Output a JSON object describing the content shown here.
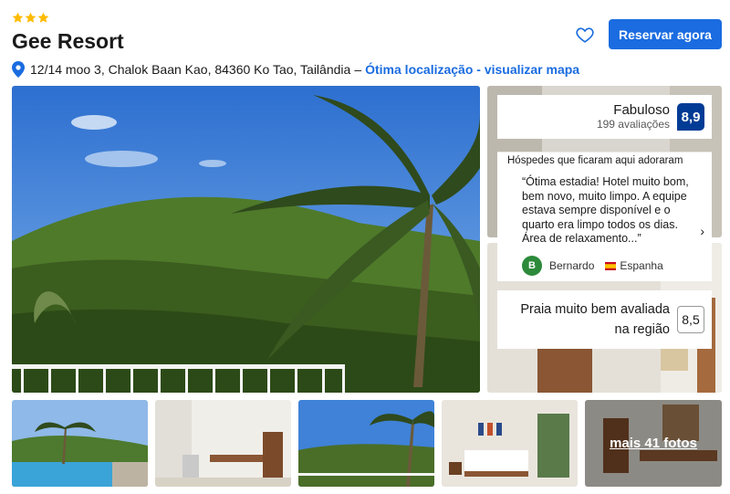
{
  "hotel": {
    "star_count": 3,
    "name": "Gee Resort",
    "address": "12/14 moo 3, Chalok Baan Kao, 84360 Ko Tao, Tailândia",
    "address_separator": "–",
    "map_link": "Ótima localização - visualizar mapa"
  },
  "actions": {
    "reserve_label": "Reservar agora",
    "favorite_icon": "heart-icon"
  },
  "rating": {
    "label": "Fabuloso",
    "count": "199 avaliações",
    "score": "8,9"
  },
  "review": {
    "heading": "Hóspedes que ficaram aqui adoraram",
    "quote": "“Ótima estadia! Hotel muito bom, bem novo, muito limpo. A equipe estava sempre disponível e o quarto era limpo todos os dias. Área de relaxamento...”",
    "reviewer_initial": "B",
    "reviewer_name": "Bernardo",
    "reviewer_country": "Espanha",
    "next_icon": "›"
  },
  "beach": {
    "label": "Praia muito bem avaliada na região",
    "score": "8,5"
  },
  "gallery": {
    "more_photos": "mais 41 fotos"
  },
  "colors": {
    "brand_blue": "#1a6ce0",
    "score_navy": "#003b95",
    "star_gold": "#febb02",
    "avatar_green": "#2c8a3a"
  }
}
